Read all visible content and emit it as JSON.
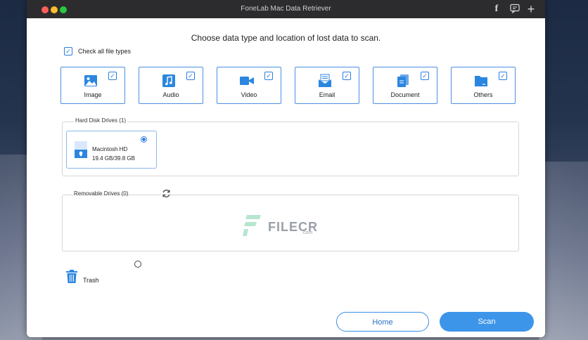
{
  "window": {
    "title": "FoneLab Mac Data Retriever"
  },
  "heading": "Choose data type and location of lost data to scan.",
  "check_all": {
    "label": "Check all file types",
    "checked": true
  },
  "file_types": [
    {
      "label": "Image",
      "icon": "image-icon",
      "checked": true
    },
    {
      "label": "Audio",
      "icon": "music-note-icon",
      "checked": true
    },
    {
      "label": "Video",
      "icon": "video-camera-icon",
      "checked": true
    },
    {
      "label": "Email",
      "icon": "envelope-icon",
      "checked": true
    },
    {
      "label": "Document",
      "icon": "document-icon",
      "checked": true
    },
    {
      "label": "Others",
      "icon": "folder-icon",
      "checked": true
    }
  ],
  "hard_disk": {
    "title": "Hard Disk Drives (1)",
    "drives": [
      {
        "name": "Macintosh HD",
        "size": "19.4 GB/39.8 GB",
        "selected": true
      }
    ]
  },
  "removable": {
    "title": "Removable Drives (0)"
  },
  "watermark": {
    "text": "FILECR",
    "sub": ".com"
  },
  "trash": {
    "label": "Trash",
    "selected": false
  },
  "buttons": {
    "home": "Home",
    "scan": "Scan"
  },
  "colors": {
    "accent": "#3d95ea",
    "titlebar": "#2c2c2e"
  }
}
